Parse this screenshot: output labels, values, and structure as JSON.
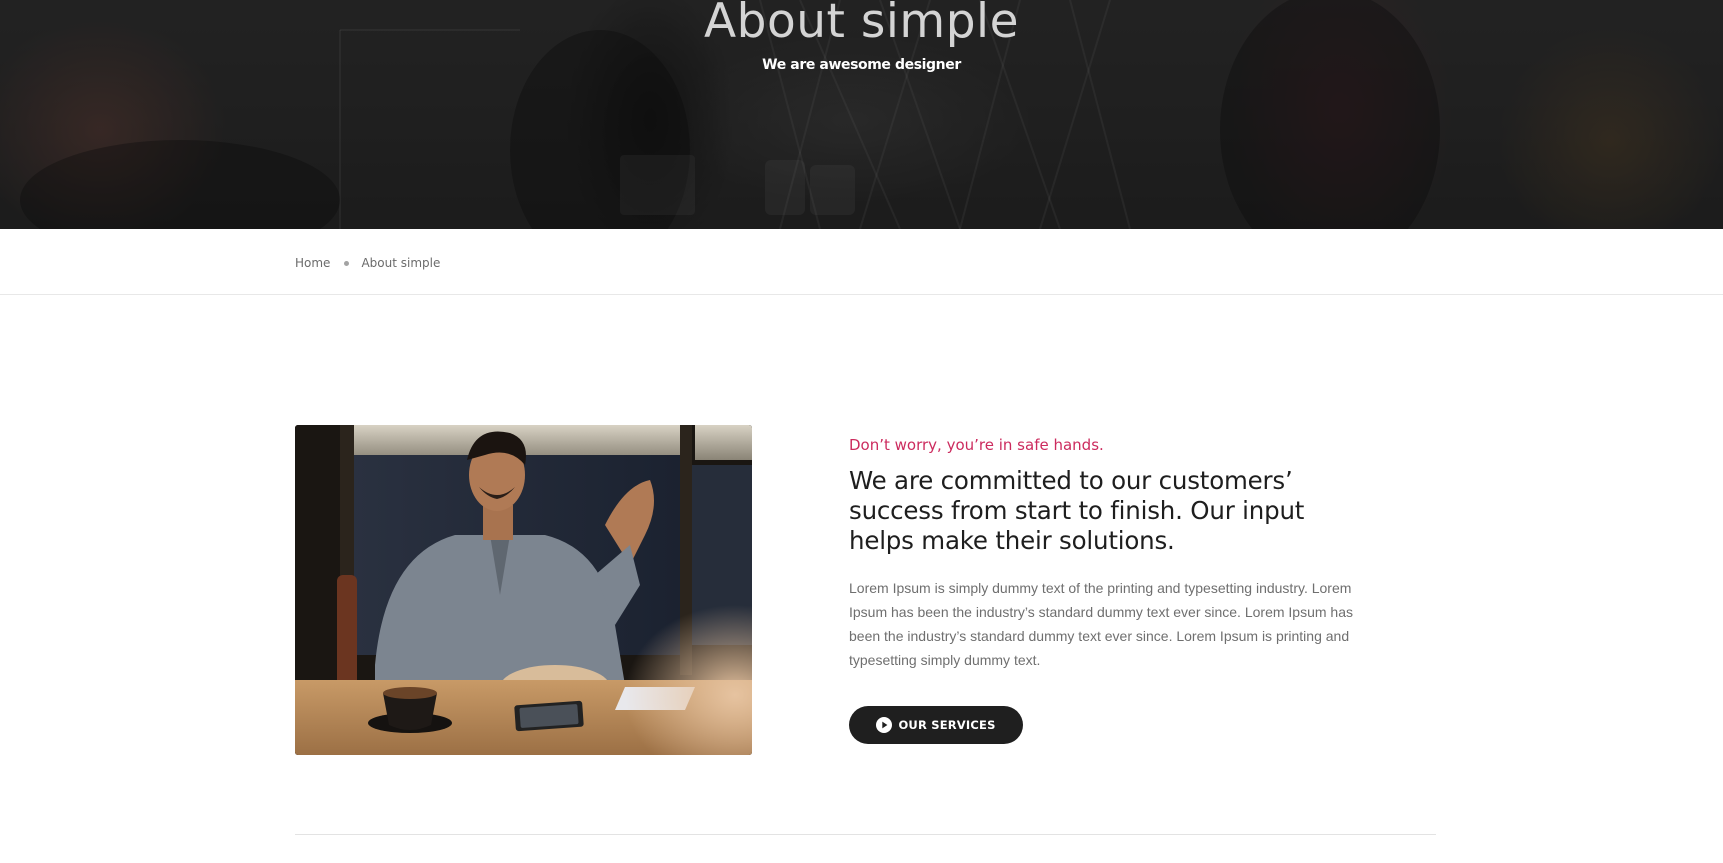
{
  "hero": {
    "title": "About simple",
    "subtitle": "We are awesome designer"
  },
  "breadcrumb": {
    "home": "Home",
    "current": "About simple"
  },
  "about": {
    "eyebrow": "Don’t worry, you’re in safe hands.",
    "headline": "We are committed to our customers’ success from start to finish. Our input helps make their solutions.",
    "body": "Lorem Ipsum is simply dummy text of the printing and typesetting industry. Lorem Ipsum has been the industry’s standard dummy text ever since. Lorem Ipsum has been the industry’s standard dummy text ever since. Lorem Ipsum is printing and typesetting simply dummy text.",
    "button_label": "OUR SERVICES",
    "button_icon": "play-circle-icon"
  },
  "colors": {
    "accent": "#cc2b5e",
    "button_bg": "#1f1f1f",
    "heading": "#1e1e1e",
    "body_text": "#6f6f6f"
  }
}
